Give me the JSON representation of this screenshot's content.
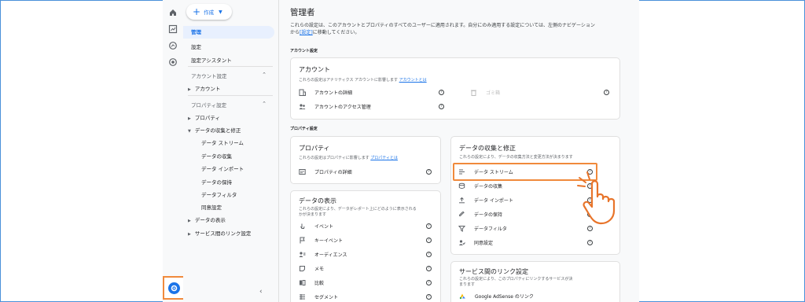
{
  "header": {
    "create_label": "作成"
  },
  "nav": {
    "admin": "管理",
    "settings": "設定",
    "setup_assistant": "設定アシスタント",
    "account_settings": "アカウント設定",
    "account": "アカウント",
    "property_settings": "プロパティ設定",
    "property": "プロパティ",
    "data_collection": "データの収集と修正",
    "sub": [
      "データ ストリーム",
      "データの収集",
      "データ インポート",
      "データの保持",
      "データフィルタ",
      "同意設定"
    ],
    "data_display": "データの表示",
    "product_links": "サービス間のリンク設定"
  },
  "main": {
    "title": "管理者",
    "desc_1": "これらの設定は、このアカウントとプロパティのすべてのユーザーに適用されます。自分にのみ適用する設定については、左側のナビゲーション",
    "desc_2a": "から",
    "desc_2_link": "[設定]",
    "desc_2b": "に移動してください。",
    "account_section": "アカウント設定",
    "property_section": "プロパティ設定"
  },
  "account_card": {
    "title": "アカウント",
    "sub": "これらの設定はアナリティクス アカウントに影響します",
    "sub_link": "アカウントとは",
    "row_details": "アカウントの詳細",
    "row_access": "アカウントのアクセス管理",
    "row_trash": "ゴミ箱"
  },
  "property_card": {
    "title": "プロパティ",
    "sub": "これらの設定はプロパティに影響します",
    "sub_link": "プロパティとは",
    "row_details": "プロパティの詳細"
  },
  "collection_card": {
    "title": "データの収集と修正",
    "sub": "これらの設定により、データの収集方法と変更方法が決まります",
    "rows": [
      "データ ストリーム",
      "データの収集",
      "データ インポート",
      "データの保持",
      "データフィルタ",
      "同意設定"
    ]
  },
  "display_card": {
    "title": "データの表示",
    "sub_1": "これらの設定により、データがレポート上にどのように表示される",
    "sub_2": "かが決まります",
    "rows": [
      "イベント",
      "キーイベント",
      "オーディエンス",
      "メモ",
      "比較",
      "セグメント"
    ]
  },
  "links_card": {
    "title": "サービス間のリンク設定",
    "sub_1": "これらの設定により、このプロパティにリンクするサービスが決",
    "sub_2": "まります",
    "row_adsense": "Google AdSense のリンク"
  },
  "colors": {
    "accent": "#1a73e8",
    "highlight": "#f08a3c"
  }
}
